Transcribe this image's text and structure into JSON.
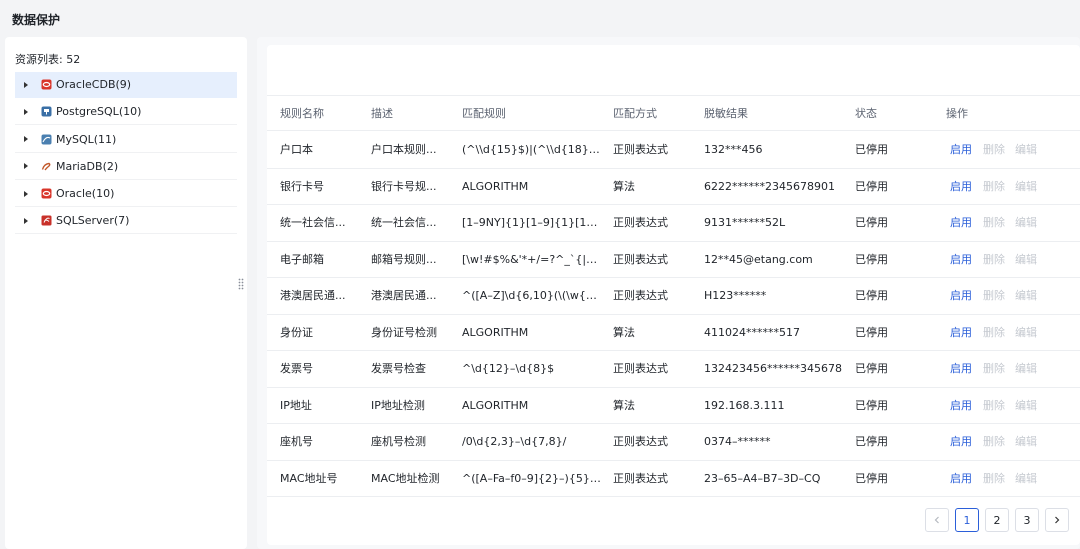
{
  "page": {
    "title": "数据保护"
  },
  "resources": {
    "label": "资源列表: 52",
    "items": [
      {
        "label": "OracleCDB(9)",
        "icon": "oracle-icon",
        "color": "#d9362b"
      },
      {
        "label": "PostgreSQL(10)",
        "icon": "postgresql-icon",
        "color": "#3a6fa6"
      },
      {
        "label": "MySQL(11)",
        "icon": "mysql-icon",
        "color": "#4a7fb0"
      },
      {
        "label": "MariaDB(2)",
        "icon": "mariadb-icon",
        "color": "#c1582a"
      },
      {
        "label": "Oracle(10)",
        "icon": "oracle-icon",
        "color": "#d9362b"
      },
      {
        "label": "SQLServer(7)",
        "icon": "sqlserver-icon",
        "color": "#c8312a"
      }
    ]
  },
  "table": {
    "headers": [
      "规则名称",
      "描述",
      "匹配规则",
      "匹配方式",
      "脱敏结果",
      "状态",
      "操作"
    ],
    "rows": [
      {
        "name": "户口本",
        "desc": "户口本规则...",
        "rule": "(^\\\\d{15}$)|(^\\\\d{18}$)|(...",
        "method": "正则表达式",
        "result": "132***456",
        "status": "已停用"
      },
      {
        "name": "银行卡号",
        "desc": "银行卡号规...",
        "rule": "ALGORITHM",
        "method": "算法",
        "result": "6222******2345678901",
        "status": "已停用"
      },
      {
        "name": "统一社会信...",
        "desc": "统一社会信...",
        "rule": "[1–9NY]{1}[1–9]{1}[1–6]{...",
        "method": "正则表达式",
        "result": "9131******52L",
        "status": "已停用"
      },
      {
        "name": "电子邮箱",
        "desc": "邮箱号规则...",
        "rule": "[\\w!#$%&'*+/=?^_`{|}~...",
        "method": "正则表达式",
        "result": "12**45@etang.com",
        "status": "已停用"
      },
      {
        "name": "港澳居民通...",
        "desc": "港澳居民通...",
        "rule": "^([A–Z]\\d{6,10}(\\(\\w{1}...",
        "method": "正则表达式",
        "result": "H123******",
        "status": "已停用"
      },
      {
        "name": "身份证",
        "desc": "身份证号检测",
        "rule": "ALGORITHM",
        "method": "算法",
        "result": "411024******517",
        "status": "已停用"
      },
      {
        "name": "发票号",
        "desc": "发票号检查",
        "rule": "^\\d{12}–\\d{8}$",
        "method": "正则表达式",
        "result": "132423456******345678",
        "status": "已停用"
      },
      {
        "name": "IP地址",
        "desc": "IP地址检测",
        "rule": "ALGORITHM",
        "method": "算法",
        "result": "192.168.3.111",
        "status": "已停用"
      },
      {
        "name": "座机号",
        "desc": "座机号检测",
        "rule": "/0\\d{2,3}–\\d{7,8}/",
        "method": "正则表达式",
        "result": "0374–******",
        "status": "已停用"
      },
      {
        "name": "MAC地址号",
        "desc": "MAC地址检测",
        "rule": "^([A–Fa–f0–9]{2}–){5}[...",
        "method": "正则表达式",
        "result": "23–65–A4–B7–3D–CQ",
        "status": "已停用"
      }
    ],
    "actions": {
      "enable": "启用",
      "delete": "删除",
      "edit": "编辑"
    }
  },
  "pagination": {
    "pages": [
      "1",
      "2",
      "3"
    ],
    "current": "1"
  },
  "colors": {
    "accent": "#2b5fd9",
    "disabled": "#c5c9d0",
    "selected_bg": "#e6effd"
  }
}
